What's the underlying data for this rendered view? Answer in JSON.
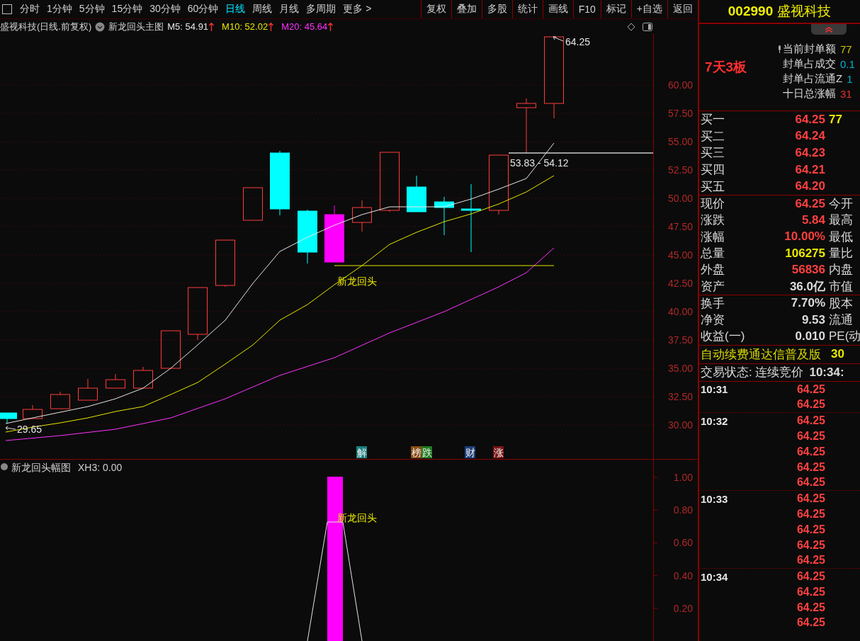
{
  "toolbar": {
    "periods": [
      {
        "label": "分时",
        "selected": false
      },
      {
        "label": "1分钟",
        "selected": false
      },
      {
        "label": "5分钟",
        "selected": false
      },
      {
        "label": "15分钟",
        "selected": false
      },
      {
        "label": "30分钟",
        "selected": false
      },
      {
        "label": "60分钟",
        "selected": false
      },
      {
        "label": "日线",
        "selected": true
      },
      {
        "label": "周线",
        "selected": false
      },
      {
        "label": "月线",
        "selected": false
      },
      {
        "label": "多周期",
        "selected": false
      },
      {
        "label": "更多 >",
        "selected": false
      }
    ],
    "buttons": [
      "复权",
      "叠加",
      "多股",
      "统计",
      "画线",
      "F10",
      "标记",
      "+自选",
      "返回"
    ]
  },
  "chart_header": {
    "title": "盛视科技(日线.前复权)",
    "indicator": "新龙回头主图",
    "averages": [
      {
        "label": "M5: 54.91",
        "color": "#e6e6e6"
      },
      {
        "label": "M10: 52.02",
        "color": "#e8e800"
      },
      {
        "label": "M20: 45.64",
        "color": "#ff33ff"
      }
    ]
  },
  "main_chart": {
    "y_ticks": [
      "60.00",
      "57.50",
      "55.00",
      "52.50",
      "50.00",
      "47.50",
      "45.00",
      "42.50",
      "40.00",
      "37.50",
      "35.00",
      "32.50",
      "30.00"
    ],
    "high_label": "64.25",
    "low_label": "29.65",
    "range_label": "53.83 - 54.12",
    "signal_label": "新龙回头",
    "events": [
      {
        "label": "解",
        "color": "#1a7f7f"
      },
      {
        "label": "榜",
        "color": "#8a4b12"
      },
      {
        "label": "跌",
        "color": "#1f7a1f"
      },
      {
        "label": "财",
        "color": "#1c3f78"
      },
      {
        "label": "涨",
        "color": "#7a1414"
      }
    ]
  },
  "sub_chart": {
    "title": "新龙回头幅图",
    "reading": "XH3: 0.00",
    "signal_label": "新龙回头",
    "y_ticks": [
      "1.00",
      "0.80",
      "0.60",
      "0.40",
      "0.20"
    ]
  },
  "quote_panel": {
    "code": "002990",
    "name": "盛视科技",
    "streak": "7天3板",
    "stats": [
      {
        "label": "当前封单额",
        "value": "77",
        "color": "#c8c800"
      },
      {
        "label": "封单占成交",
        "value": "0.1",
        "color": "#00b4d0"
      },
      {
        "label": "封单占流通Z",
        "value": "1",
        "color": "#00b4d0"
      },
      {
        "label": "十日总涨幅",
        "value": "31",
        "color": "#e03030"
      }
    ],
    "bids": [
      {
        "label": "买一",
        "price": "64.25",
        "volume": "77"
      },
      {
        "label": "买二",
        "price": "64.24"
      },
      {
        "label": "买三",
        "price": "64.23"
      },
      {
        "label": "买四",
        "price": "64.21"
      },
      {
        "label": "买五",
        "price": "64.20"
      }
    ],
    "quotes": [
      {
        "label": "现价",
        "value": "64.25",
        "color": "#ff4040",
        "right": "今开"
      },
      {
        "label": "涨跌",
        "value": "5.84",
        "color": "#ff4040",
        "right": "最高"
      },
      {
        "label": "涨幅",
        "value": "10.00%",
        "color": "#ff4040",
        "right": "最低"
      },
      {
        "label": "总量",
        "value": "106275",
        "color": "#e8e800",
        "right": "量比"
      },
      {
        "label": "外盘",
        "value": "56836",
        "color": "#ff4040",
        "right": "内盘"
      },
      {
        "label": "资产",
        "value": "36.0亿",
        "color": "#dddddd",
        "right": "市值"
      }
    ],
    "finance": [
      {
        "label": "换手",
        "value": "7.70%",
        "right": "股本"
      },
      {
        "label": "净资",
        "value": "9.53",
        "right": "流通"
      },
      {
        "label": "收益(一)",
        "value": "0.010",
        "right": "PE(动"
      }
    ],
    "notice": {
      "text": "自动续费通达信普及版",
      "value": "30"
    },
    "status": {
      "text": "交易状态: 连续竞价",
      "time": "10:34:"
    },
    "ticks": [
      {
        "time": "10:31",
        "prices": [
          "64.25",
          "64.25"
        ]
      },
      {
        "time": "10:32",
        "prices": [
          "64.25",
          "64.25",
          "64.25",
          "64.25",
          "64.25"
        ]
      },
      {
        "time": "10:33",
        "prices": [
          "64.25",
          "64.25",
          "64.25",
          "64.25",
          "64.25"
        ]
      },
      {
        "time": "10:34",
        "prices": [
          "64.25",
          "64.25",
          "64.25",
          "64.25"
        ]
      }
    ]
  }
}
